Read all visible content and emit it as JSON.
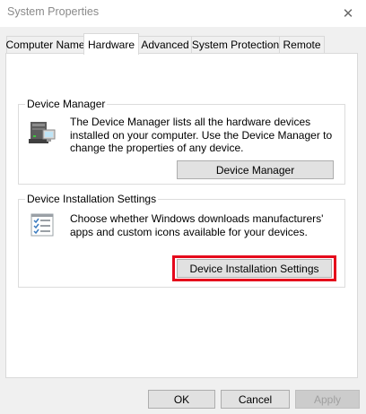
{
  "window": {
    "title": "System Properties",
    "close_icon": "close-icon"
  },
  "tabs": [
    {
      "label": "Computer Name",
      "active": false
    },
    {
      "label": "Hardware",
      "active": true
    },
    {
      "label": "Advanced",
      "active": false
    },
    {
      "label": "System Protection",
      "active": false
    },
    {
      "label": "Remote",
      "active": false
    }
  ],
  "device_manager": {
    "group_label": "Device Manager",
    "description": "The Device Manager lists all the hardware devices installed on your computer. Use the Device Manager to change the properties of any device.",
    "button_label": "Device Manager",
    "icon": "device-manager-icon"
  },
  "device_installation": {
    "group_label": "Device Installation Settings",
    "description": "Choose whether Windows downloads manufacturers' apps and custom icons available for your devices.",
    "button_label": "Device Installation Settings",
    "icon": "checklist-icon",
    "highlight_color": "#e5071b"
  },
  "footer": {
    "ok_label": "OK",
    "cancel_label": "Cancel",
    "apply_label": "Apply"
  }
}
